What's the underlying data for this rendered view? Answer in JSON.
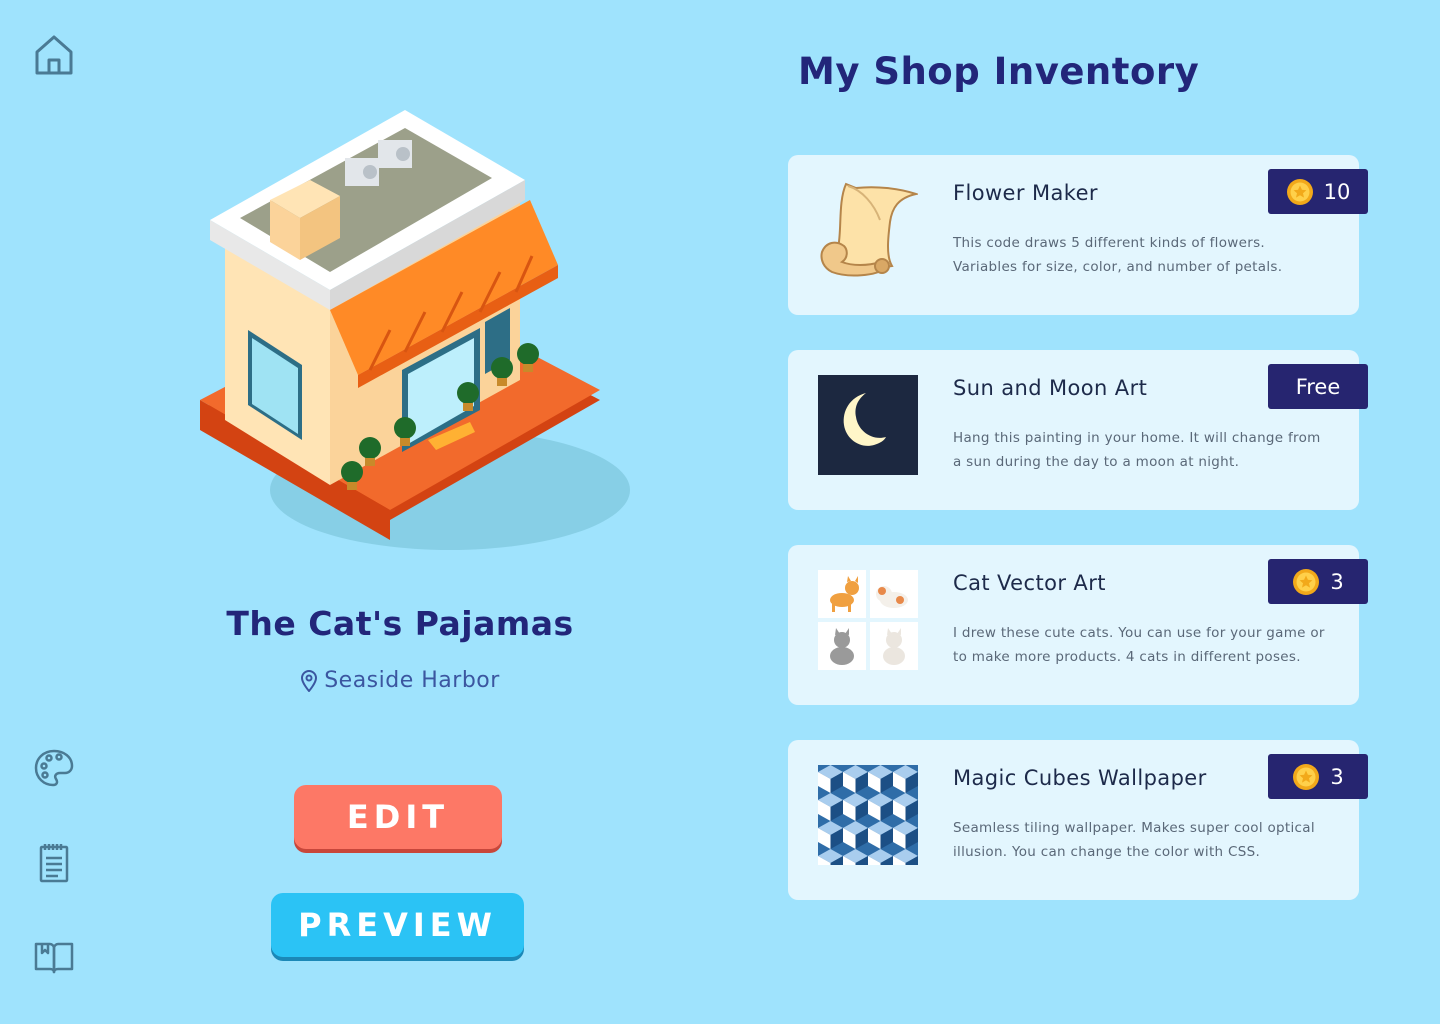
{
  "sidebar": {
    "items": [
      {
        "icon": "home-icon"
      },
      {
        "icon": "palette-icon"
      },
      {
        "icon": "notepad-icon"
      },
      {
        "icon": "book-icon"
      }
    ],
    "icon_color": "#4a7a94"
  },
  "shop": {
    "name": "The Cat's Pajamas",
    "location": "Seaside Harbor",
    "location_icon": "map-pin-icon"
  },
  "actions": {
    "edit_label": "EDIT",
    "preview_label": "PREVIEW"
  },
  "inventory": {
    "title": "My Shop Inventory",
    "items": [
      {
        "thumb_icon": "scroll-icon",
        "title": "Flower Maker",
        "description": "This code draws 5 different kinds of flowers. Variables for size, color, and number of petals.",
        "price": "10",
        "price_icon": "coin-icon"
      },
      {
        "thumb_icon": "moon-icon",
        "title": "Sun and Moon Art",
        "description": "Hang this painting in your home. It will change from a sun during the day to a moon at night.",
        "price": "Free",
        "price_icon": ""
      },
      {
        "thumb_icon": "cats-icon",
        "title": "Cat Vector Art",
        "description": "I drew these cute cats. You can use for your game or to make more products. 4 cats in different poses.",
        "price": "3",
        "price_icon": "coin-icon"
      },
      {
        "thumb_icon": "cubes-pattern-icon",
        "title": "Magic Cubes Wallpaper",
        "description": "Seamless tiling wallpaper. Makes super cool optical illusion. You can change the color with CSS.",
        "price": "3",
        "price_icon": "coin-icon"
      }
    ]
  },
  "colors": {
    "background": "#9fe3fd",
    "title": "#22267a",
    "price_tag": "#262570",
    "edit_button": "#fd7866",
    "preview_button": "#2bc3f5",
    "card": "#e3f6fe"
  }
}
